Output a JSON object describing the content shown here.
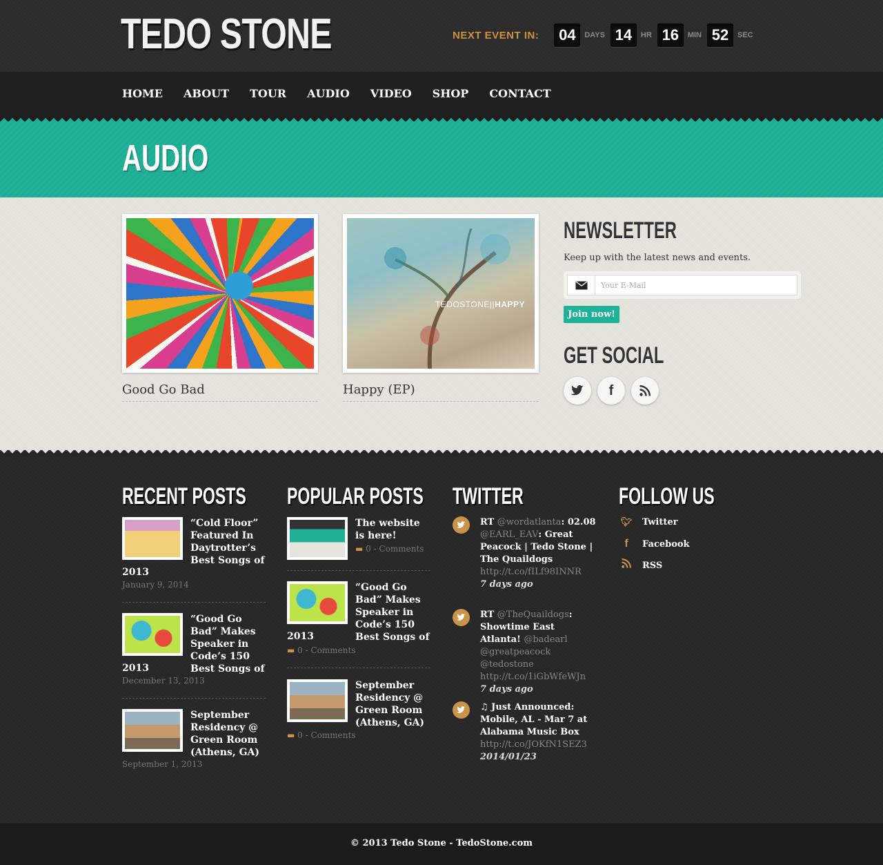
{
  "header": {
    "logo": "TEDO STONE",
    "countdown": {
      "label": "NEXT EVENT IN:",
      "days": "04",
      "days_unit": "DAYS",
      "hours": "14",
      "hours_unit": "HR",
      "minutes": "16",
      "minutes_unit": "MIN",
      "seconds": "52",
      "seconds_unit": "SEC"
    }
  },
  "nav": [
    "HOME",
    "ABOUT",
    "TOUR",
    "AUDIO",
    "VIDEO",
    "SHOP",
    "CONTACT"
  ],
  "page_title": "AUDIO",
  "albums": [
    {
      "title": "Good Go Bad"
    },
    {
      "title": "Happy (EP)",
      "cover_text_a": "TEDOSTONE||",
      "cover_text_b": "HAPPY"
    }
  ],
  "newsletter": {
    "title": "NEWSLETTER",
    "text": "Keep up with the latest news and events.",
    "placeholder": "Your E-Mail",
    "button": "Join now!"
  },
  "social": {
    "title": "GET SOCIAL",
    "icons": [
      "twitter-icon",
      "facebook-icon",
      "rss-icon"
    ]
  },
  "recent_posts": {
    "title": "RECENT POSTS",
    "items": [
      {
        "title": "“Cold Floor” Featured In Daytrotter’s Best Songs of",
        "cont": "2013",
        "date": "January 9, 2014"
      },
      {
        "title": "“Good Go Bad” Makes Speaker in Code’s 150 Best Songs of",
        "cont": "2013",
        "date": "December 13, 2013"
      },
      {
        "title": "September Residency @ Green Room (Athens, GA)",
        "cont": "",
        "date": "September 1, 2013"
      }
    ]
  },
  "popular_posts": {
    "title": "POPULAR POSTS",
    "items": [
      {
        "title": "The website is here!",
        "cont": "",
        "comments": "0 - Comments"
      },
      {
        "title": "“Good Go Bad” Makes Speaker in Code’s 150 Best Songs of",
        "cont": "2013",
        "comments": "0 - Comments"
      },
      {
        "title": "September Residency @ Green Room (Athens, GA)",
        "cont": "",
        "comments": "0 - Comments"
      }
    ]
  },
  "twitter": {
    "title": "TWITTER",
    "tweets": [
      {
        "a": "RT ",
        "b": "@wordatlanta",
        "c": ": 02.08 ",
        "d": "@EARL_EAV",
        "e": ": Great Peacock | Tedo Stone | The Quaildogs ",
        "link": "http://t.co/fILf98INNR",
        "ago": "7 days ago"
      },
      {
        "a": "RT ",
        "b": "@TheQuaildogs",
        "c": ": Showtime East Atlanta! ",
        "d": "@badearl @greatpeacock @tedostone",
        "e": " ",
        "link": "http://t.co/1iGbWfeWJn",
        "ago": "7 days ago"
      },
      {
        "a": "♫ Just Announced: Mobile, AL - Mar 7 at Alabama Music Box ",
        "b": "",
        "c": "",
        "d": "",
        "e": "",
        "link": "http://t.co/JOKfN1SEZ3",
        "ago": "2014/01/23"
      }
    ]
  },
  "follow": {
    "title": "FOLLOW US",
    "items": [
      "Twitter",
      "Facebook",
      "RSS"
    ]
  },
  "footer": {
    "copyright": "© 2013 Tedo Stone - TedoStone.com"
  },
  "colors": {
    "accent": "#20b298",
    "orange": "#d0933c",
    "dark": "#262626"
  }
}
